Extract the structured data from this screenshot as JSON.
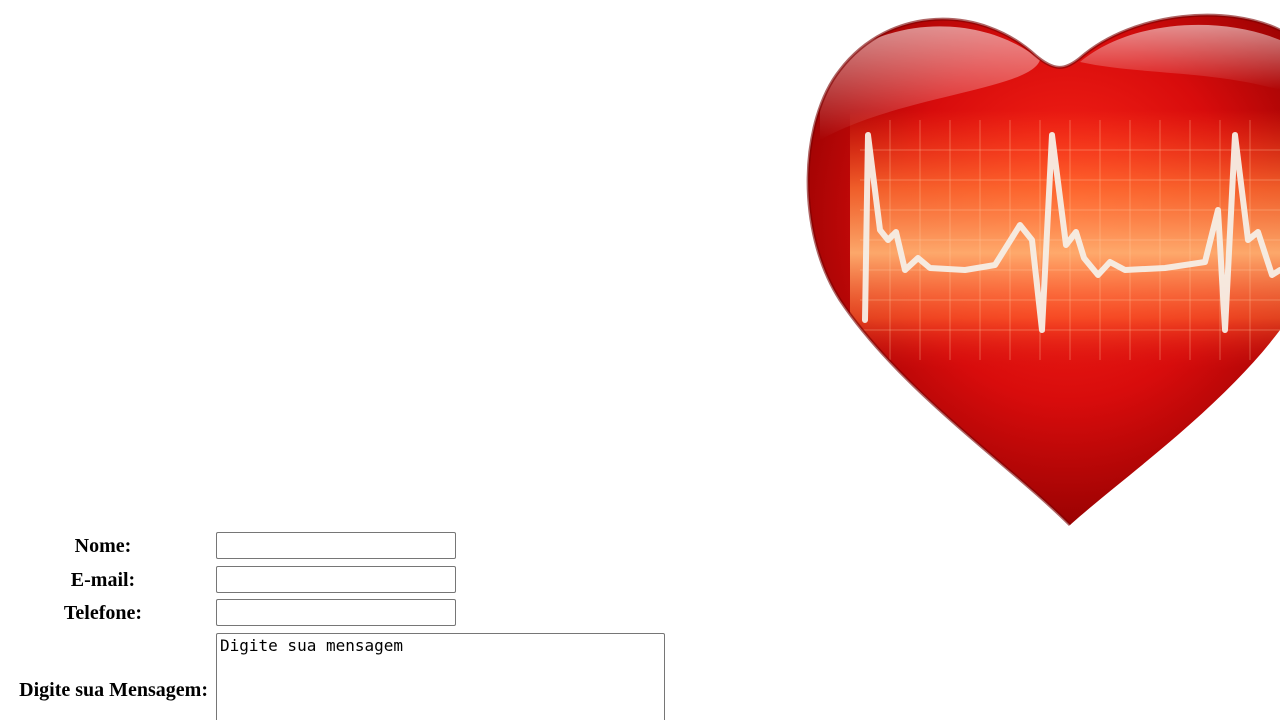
{
  "form": {
    "nome_label": "Nome:",
    "nome_value": "",
    "email_label": "E-mail:",
    "email_value": "",
    "telefone_label": "Telefone:",
    "telefone_value": "",
    "mensagem_label": "Digite sua Mensagem:",
    "mensagem_value": "Digite sua mensagem"
  },
  "image": {
    "subject": "heart-with-ekg-line-icon",
    "colors": {
      "heart_dark": "#a80000",
      "heart_main": "#e01010",
      "glow": "#ff8a40",
      "ekg_line": "#f5f0ea"
    }
  }
}
